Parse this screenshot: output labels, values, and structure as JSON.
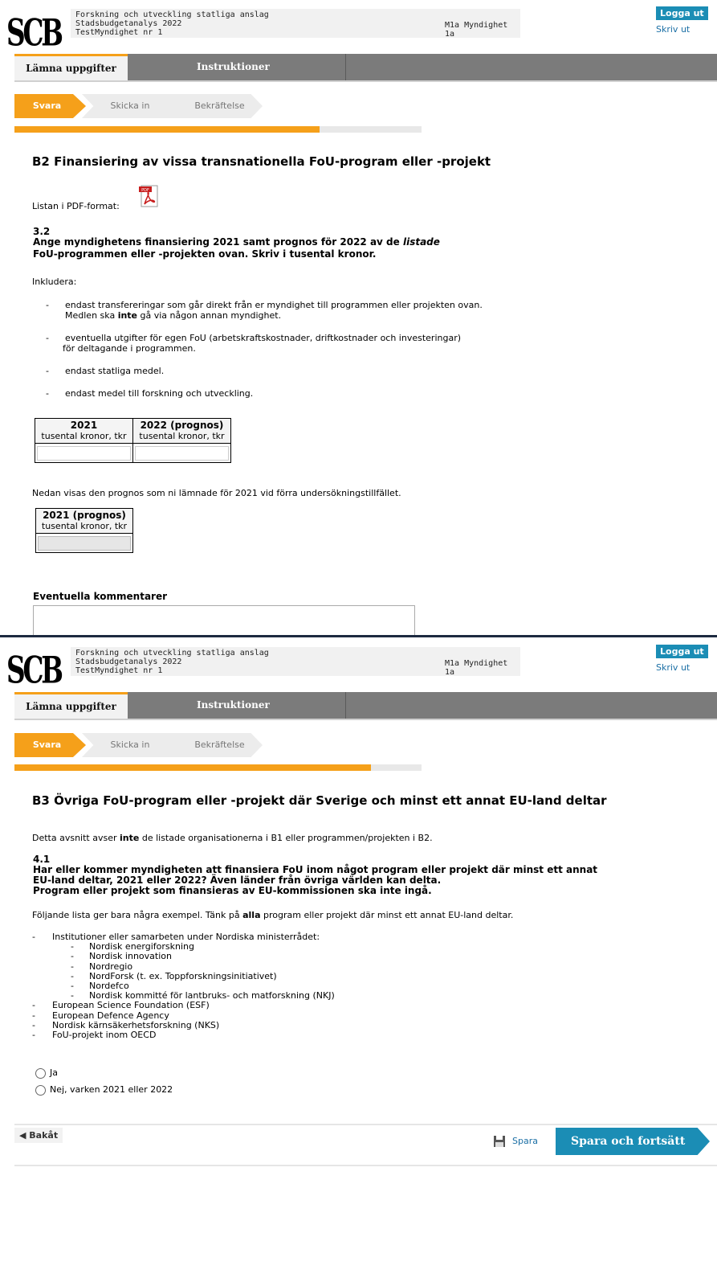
{
  "header": {
    "logo": "SCB",
    "lines": [
      "Forskning och utveckling statliga anslag",
      "Stadsbudgetanalys 2022",
      "TestMyndighet nr 1"
    ],
    "org": "M1a Myndighet 1a",
    "logout": "Logga ut",
    "print": "Skriv ut"
  },
  "tabs": [
    "Lämna uppgifter",
    "Instruktioner"
  ],
  "steps": [
    "Svara",
    "Skicka in",
    "Bekräftelse"
  ],
  "footer": {
    "back": "◀ Bakåt",
    "save": "Spara",
    "continue": "Spara och fortsätt"
  },
  "page1": {
    "progress_fraction": 0.75,
    "title": "B2 Finansiering av vissa transnationella FoU-program eller -projekt",
    "pdf_label": "Listan i PDF-format:",
    "q_number": "3.2",
    "q_line1a": "Ange myndighetens finansiering 2021 samt prognos för 2022 av de ",
    "q_line1b": "listade",
    "q_line2": "FoU-programmen eller -projekten ovan. Skriv i tusental kronor.",
    "include": "Inkludera:",
    "bullet1a": "endast transfereringar som går direkt från er myndighet till programmen eller projekten ovan.",
    "bullet1b_pre": "Medlen ska ",
    "bullet1b_bold": "inte",
    "bullet1b_post": " gå via någon annan myndighet.",
    "bullet2a": "eventuella utgifter för egen FoU (arbetskraftskostnader, driftkostnader och investeringar)",
    "bullet2b": "för deltagande i programmen.",
    "bullet3": "endast statliga medel.",
    "bullet4": "endast medel till forskning och utveckling.",
    "dash": "-",
    "table_headers": [
      {
        "year": "2021",
        "unit": "tusental kronor, tkr"
      },
      {
        "year": "2022 (prognos)",
        "unit": "tusental kronor, tkr"
      }
    ],
    "prev_text": "Nedan visas den prognos som ni lämnade för 2021 vid förra undersökningstillfället.",
    "prev_header": {
      "year": "2021 (prognos)",
      "unit": "tusental kronor, tkr"
    },
    "comments_label": "Eventuella kommentarer"
  },
  "page2": {
    "progress_fraction": 0.875,
    "title": "B3 Övriga FoU-program eller -projekt där Sverige och minst ett annat EU-land deltar",
    "intro_pre": "Detta avsnitt avser ",
    "intro_bold": "inte",
    "intro_post": " de listade organisationerna i B1 eller programmen/projekten i B2.",
    "q_number": "4.1",
    "q_line1": "Har eller kommer myndigheten att finansiera FoU inom något program eller projekt där minst ett annat",
    "q_line2": "EU-land deltar, 2021 eller 2022? Även länder från övriga världen kan delta.",
    "q_line3": "Program eller projekt som finansieras av EU-kommissionen ska inte ingå.",
    "list_intro_pre": "Följande lista ger bara några exempel. Tänk på ",
    "list_intro_bold": "alla",
    "list_intro_post": " program eller projekt där minst ett annat EU-land deltar.",
    "list_top": "Institutioner eller samarbeten under Nordiska ministerrådet:",
    "sublist": [
      "Nordisk energiforskning",
      "Nordisk innovation",
      "Nordregio",
      "NordForsk (t. ex. Toppforskningsinitiativet)",
      "Nordefco",
      "Nordisk kommitté för lantbruks- och matforskning (NKJ)"
    ],
    "list_rest": [
      "European Science Foundation (ESF)",
      "European Defence Agency",
      "Nordisk kärnsäkerhetsforskning (NKS)",
      "FoU-projekt inom OECD"
    ],
    "radio_yes": "Ja",
    "radio_no": "Nej, varken 2021 eller 2022"
  }
}
